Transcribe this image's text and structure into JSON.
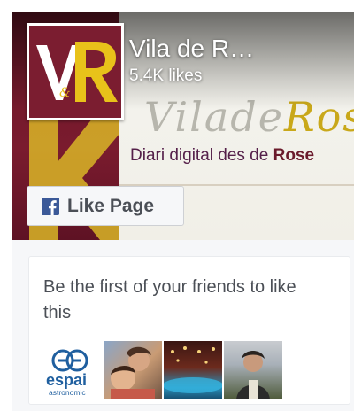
{
  "page": {
    "title": "Vila de R…",
    "likes": "5.4K likes"
  },
  "cover": {
    "logo_text": "VR",
    "script_text_a": "Vilade",
    "script_text_b": "Ros",
    "tagline_prefix": "Diari digital des de ",
    "tagline_bold": "Rose"
  },
  "like_button": {
    "label": "Like Page",
    "icon": "facebook-f-icon"
  },
  "friends": {
    "message": "Be the first of your friends to like this",
    "avatars": [
      {
        "name": "espai-astronomic-avatar",
        "text": "espai",
        "subtext": "astronomic"
      },
      {
        "name": "friend-avatar-2"
      },
      {
        "name": "friend-avatar-3"
      },
      {
        "name": "friend-avatar-4"
      }
    ]
  },
  "colors": {
    "maroon": "#7b1d30",
    "facebook_blue": "#3b5998",
    "logo_yellow": "#e8c21a",
    "text_gray": "#4b4f56"
  }
}
